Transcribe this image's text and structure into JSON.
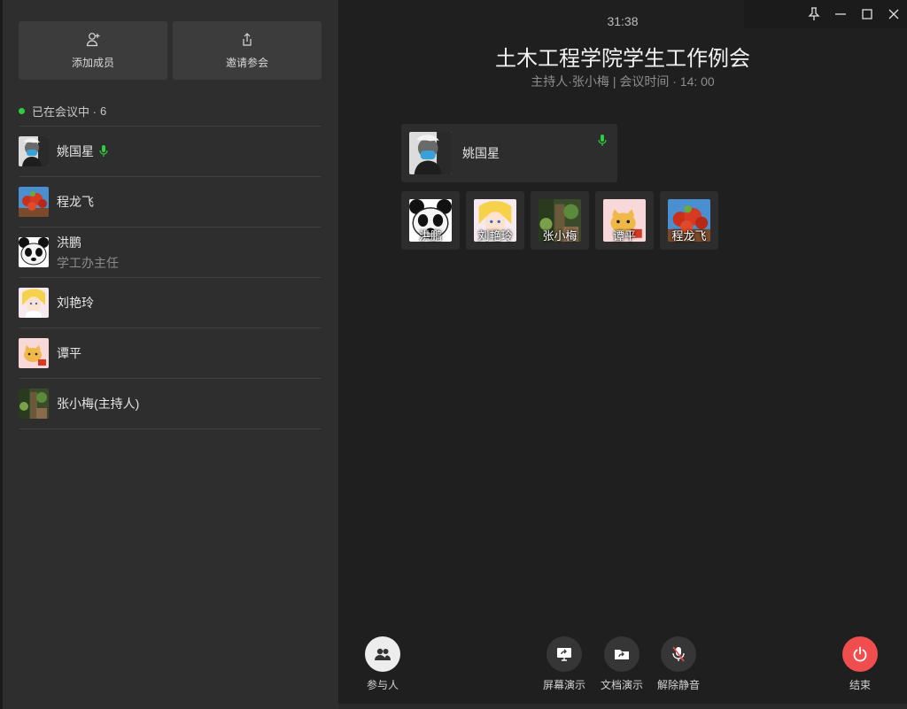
{
  "sidebar": {
    "add_member_label": "添加成员",
    "invite_label": "邀请参会",
    "status_text": "已在会议中 ·",
    "status_count": "6",
    "members": [
      {
        "name": "姚国星",
        "role": "",
        "speaking": true,
        "avatar": "masked-person-avatar"
      },
      {
        "name": "程龙飞",
        "role": "",
        "speaking": false,
        "avatar": "flower-basket-avatar"
      },
      {
        "name": "洪鹏",
        "role": "学工办主任",
        "speaking": false,
        "avatar": "panda-avatar"
      },
      {
        "name": "刘艳玲",
        "role": "",
        "speaking": false,
        "avatar": "anime-girl-avatar"
      },
      {
        "name": "谭平",
        "role": "",
        "speaking": false,
        "avatar": "cartoon-cat-avatar"
      },
      {
        "name": "张小梅(主持人)",
        "role": "",
        "speaking": false,
        "avatar": "garden-avatar"
      }
    ]
  },
  "meeting": {
    "timer": "31:38",
    "title": "土木工程学院学生工作例会",
    "subtitle": "主持人·张小梅 | 会议时间 · 14: 00",
    "active_speaker": "姚国星",
    "tiles": [
      "洪鹏",
      "刘艳玲",
      "张小梅",
      "谭平",
      "程龙飞"
    ]
  },
  "toolbar": {
    "participants_label": "参与人",
    "screen_share_label": "屏幕演示",
    "doc_share_label": "文档演示",
    "unmute_label": "解除静音",
    "end_label": "结束"
  },
  "colors": {
    "speaking_green": "#2ecc40",
    "end_red": "#f04e4e",
    "sidebar_bg": "#2e2e2e",
    "main_bg": "#1f1f1f"
  }
}
